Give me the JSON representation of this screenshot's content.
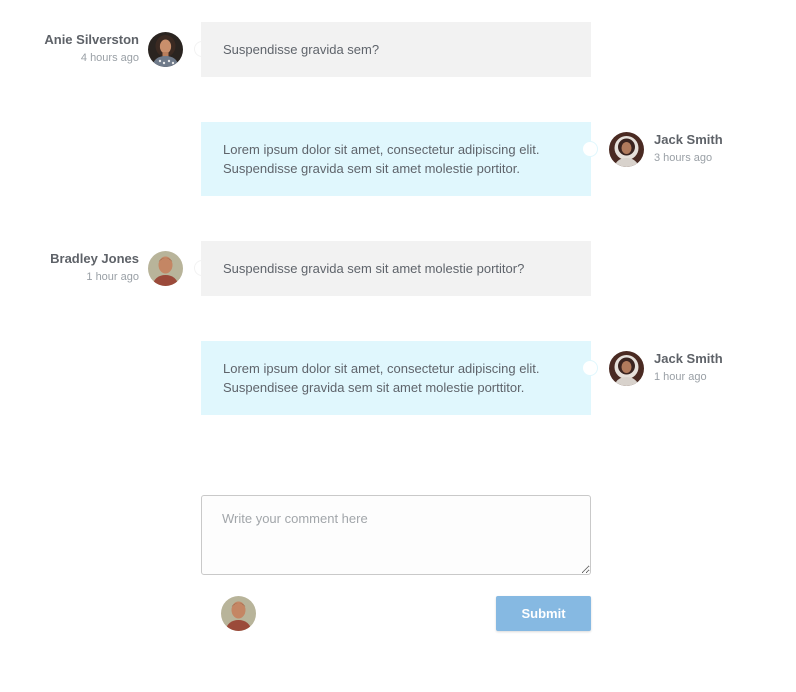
{
  "messages": [
    {
      "author": "Anie Silverston",
      "time": "4 hours ago",
      "text": "Suspendisse gravida sem?",
      "side": "left",
      "avatar_icon": "woman-avatar"
    },
    {
      "author": "Jack Smith",
      "time": "3 hours ago",
      "text": "Lorem ipsum dolor sit amet, consectetur adipiscing elit.\nSuspendisse gravida sem sit amet molestie portitor.",
      "side": "right",
      "avatar_icon": "astronaut-avatar"
    },
    {
      "author": "Bradley Jones",
      "time": "1 hour ago",
      "text": "Suspendisse gravida sem sit amet molestie portitor?",
      "side": "left",
      "avatar_icon": "man-avatar"
    },
    {
      "author": "Jack Smith",
      "time": "1 hour ago",
      "text": "Lorem ipsum dolor sit amet, consectetur adipiscing elit.\nSuspendisee gravida sem sit amet molestie porttitor.",
      "side": "right",
      "avatar_icon": "astronaut-avatar"
    }
  ],
  "composer": {
    "placeholder": "Write your comment here",
    "value": "",
    "submit_label": "Submit",
    "avatar_icon": "man-avatar"
  },
  "colors": {
    "incoming_bubble": "#f2f2f2",
    "outgoing_bubble": "#e0f7fd",
    "submit_button": "#86b9e2",
    "name_text": "#5e6268",
    "time_text": "#9aa0a6"
  }
}
